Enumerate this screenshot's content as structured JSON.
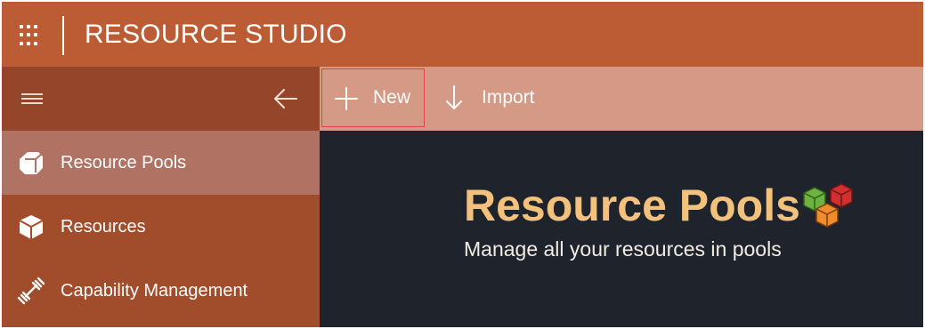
{
  "header": {
    "app_title": "RESOURCE STUDIO"
  },
  "sidebar": {
    "items": [
      {
        "label": "Resource Pools",
        "icon": "cube-solid-icon",
        "active": true
      },
      {
        "label": "Resources",
        "icon": "box-icon",
        "active": false
      },
      {
        "label": "Capability Management",
        "icon": "dumbbell-icon",
        "active": false
      }
    ]
  },
  "toolbar": {
    "new_label": "New",
    "import_label": "Import"
  },
  "main": {
    "title": "Resource Pools",
    "subtitle": "Manage all your resources in pools"
  },
  "colors": {
    "header": "#bb5c35",
    "sidebar": "#a14d2b",
    "sidebar_active": "#b07262",
    "toolbar": "#d49a86",
    "content_bg": "#1f232c",
    "title": "#f2c27d"
  }
}
